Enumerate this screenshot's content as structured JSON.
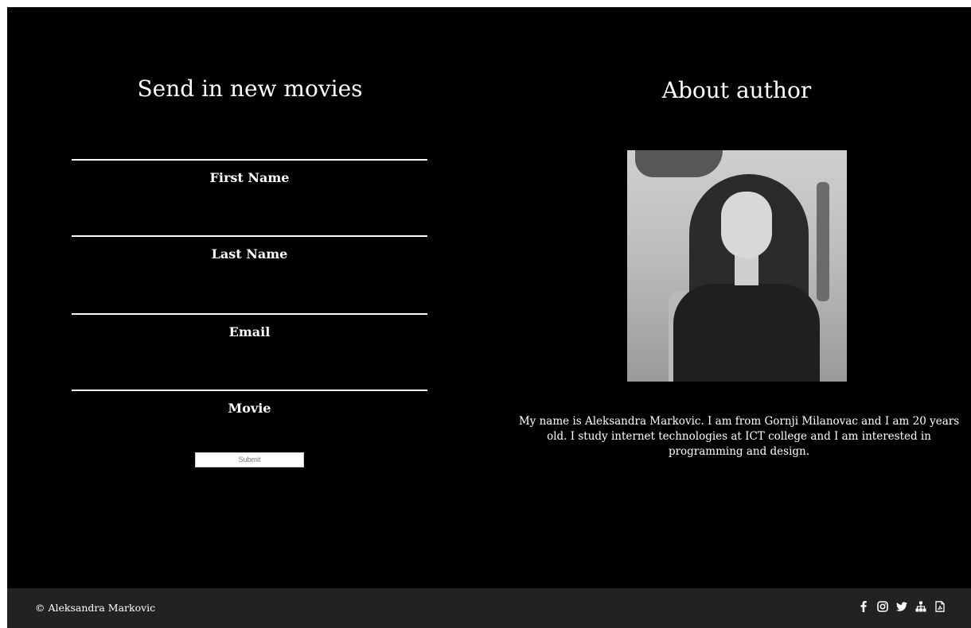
{
  "form": {
    "title": "Send in new movies",
    "fields": [
      {
        "label": "First Name",
        "value": ""
      },
      {
        "label": "Last Name",
        "value": ""
      },
      {
        "label": "Email",
        "value": ""
      },
      {
        "label": "Movie",
        "value": ""
      }
    ],
    "submit_label": "Submit"
  },
  "about": {
    "title": "About author",
    "bio": "My name is Aleksandra Markovic. I am from Gornji Milanovac and I am 20 years old. I study internet technologies at ICT college and I am interested in programming and design."
  },
  "footer": {
    "copyright": "© Aleksandra Markovic",
    "social_icons": [
      "facebook-icon",
      "instagram-icon",
      "twitter-icon",
      "sitemap-icon",
      "pdf-icon"
    ]
  },
  "colors": {
    "background": "#000000",
    "text": "#ffffff",
    "footer": "#222222"
  }
}
